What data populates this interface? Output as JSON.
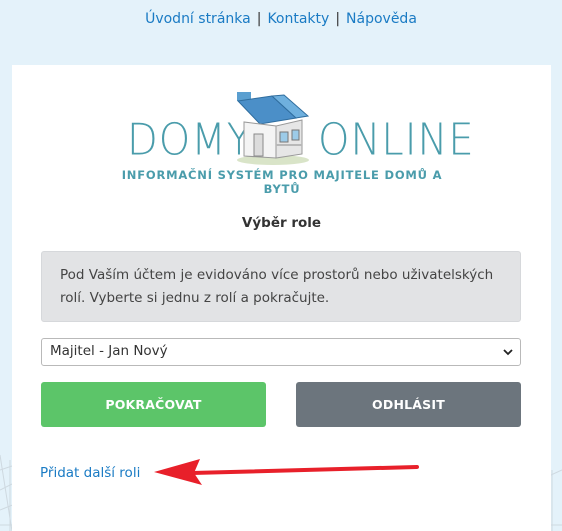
{
  "topnav": {
    "home": "Úvodní stránka",
    "separator": "|",
    "contacts": "Kontakty",
    "help": "Nápověda"
  },
  "logo": {
    "word_left": "DOMY",
    "word_right": "ONLINE",
    "tagline": "INFORMAČNÍ SYSTÉM PRO MAJITELE DOMŮ A BYTŮ"
  },
  "role_selection": {
    "title": "Výběr role",
    "info_text": "Pod Vaším účtem je evidováno více prostorů nebo uživatelských rolí. Vyberte si jednu z rolí a pokračujte.",
    "selected_role": "Majitel - Jan Nový",
    "continue_label": "POKRAČOVAT",
    "logout_label": "ODHLÁSIT",
    "add_role_link": "Přidat další roli"
  },
  "colors": {
    "link": "#1a7bc4",
    "continue_button": "#5cc569",
    "logout_button": "#6c757d",
    "info_box": "#e2e3e5",
    "logo_teal": "#4a9cab",
    "arrow": "#e8202a"
  },
  "icons": [
    "house-logo-icon",
    "chevron-down-icon",
    "red-arrow-annotation"
  ]
}
